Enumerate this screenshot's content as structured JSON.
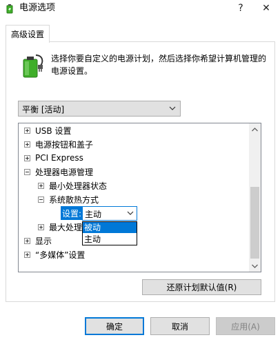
{
  "window": {
    "title": "电源选项",
    "help_label": "?",
    "close_label": "✕"
  },
  "tab": {
    "label": "高级设置"
  },
  "description": "选择你要自定义的电源计划，然后选择你希望计算机管理的电源设置。",
  "plan_select": {
    "value": "平衡 [活动]"
  },
  "tree": {
    "items": [
      {
        "label": "USB 设置",
        "state": "collapsed"
      },
      {
        "label": "电源按钮和盖子",
        "state": "collapsed"
      },
      {
        "label": "PCI Express",
        "state": "collapsed"
      },
      {
        "label": "处理器电源管理",
        "state": "expanded"
      },
      {
        "label": "最小处理器状态",
        "state": "collapsed"
      },
      {
        "label": "系统散热方式",
        "state": "expanded"
      },
      {
        "label": "最大处理器状态",
        "state": "collapsed"
      },
      {
        "label": "显示",
        "state": "collapsed"
      },
      {
        "label": "“多媒体”设置",
        "state": "collapsed"
      }
    ],
    "setting_label": "设置:",
    "setting_value": "主动"
  },
  "dropdown_options": [
    "被动",
    "主动"
  ],
  "restore_button": "还原计划默认值(R)",
  "footer": {
    "ok": "确定",
    "cancel": "取消",
    "apply": "应用(A)"
  },
  "colors": {
    "accent": "#0078d7",
    "battery_green": "#3fae29"
  },
  "icons": [
    "battery-plug-icon",
    "chevron-down-icon",
    "scroll-up-icon",
    "scroll-down-icon"
  ]
}
